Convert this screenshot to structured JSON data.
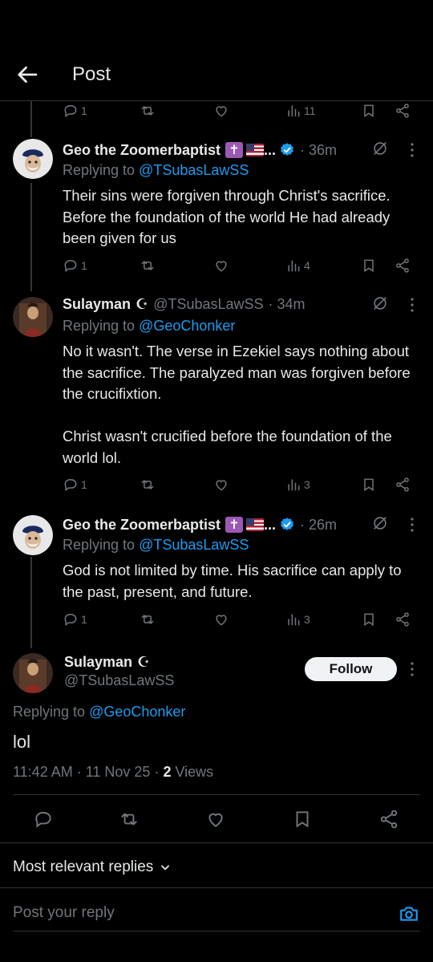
{
  "header": {
    "title": "Post"
  },
  "top_actions": {
    "replies": "1",
    "views": "11"
  },
  "tweets": [
    {
      "name": "Geo the Zoomerbaptist",
      "name_suffix": "...",
      "time": "· 36m",
      "replying_prefix": "Replying to ",
      "replying_to": "@TSubasLawSS",
      "text": "Their sins were forgiven through Christ's sacrifice. Before the foundation of the world He had already been given for us",
      "replies": "1",
      "views": "4"
    },
    {
      "name": "Sulayman",
      "name_symbol": "☪",
      "handle": "@TSubasLawSS",
      "time": "· 34m",
      "replying_prefix": "Replying to ",
      "replying_to": "@GeoChonker",
      "text": "No it wasn't. The verse in Ezekiel says nothing about the sacrifice. The paralyzed man was forgiven before the crucifixtion.\n\nChrist wasn't crucified before the foundation of the world lol.",
      "replies": "1",
      "views": "3"
    },
    {
      "name": "Geo the Zoomerbaptist",
      "name_suffix": "...",
      "time": "· 26m",
      "replying_prefix": "Replying to ",
      "replying_to": "@TSubasLawSS",
      "text": "God is not limited by time. His sacrifice can apply to the past, present, and future.",
      "replies": "1",
      "views": "3"
    }
  ],
  "main_post": {
    "name": "Sulayman",
    "name_symbol": "☪",
    "handle": "@TSubasLawSS",
    "follow_label": "Follow",
    "replying_prefix": "Replying to ",
    "replying_to": "@GeoChonker",
    "text": "lol",
    "meta": "11:42 AM · 11 Nov 25 · ",
    "views_count": "2",
    "views_label": " Views"
  },
  "sort_label": "Most relevant replies",
  "reply_placeholder": "Post your reply",
  "colors": {
    "accent": "#1d9bf0",
    "muted": "#71767b",
    "background": "#000000",
    "text": "#e7e9ea"
  }
}
